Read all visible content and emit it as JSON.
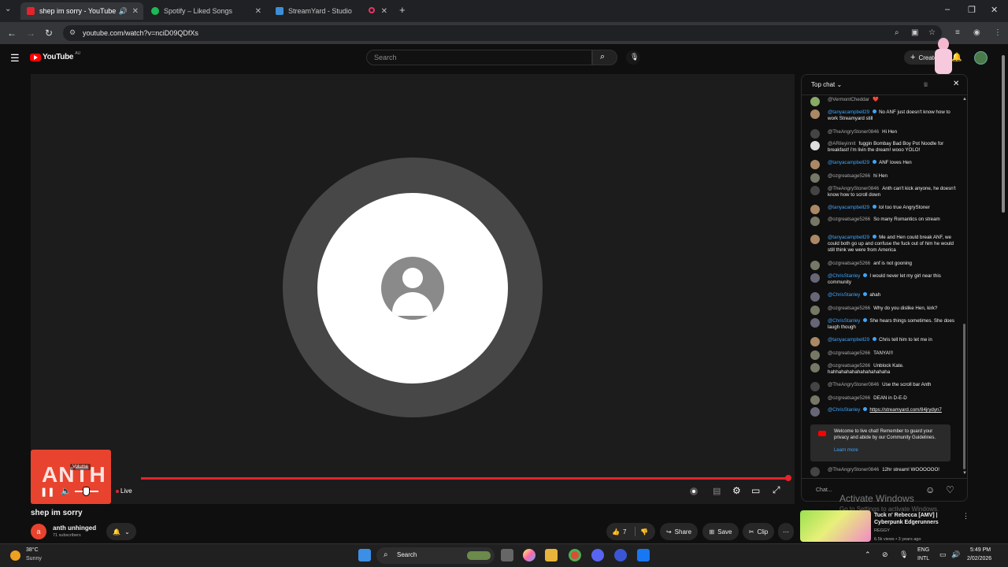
{
  "browser": {
    "tabs": [
      {
        "label": "shep im sorry - YouTube",
        "active": true
      },
      {
        "label": "Spotify – Liked Songs",
        "active": false
      },
      {
        "label": "StreamYard - Studio",
        "active": false
      }
    ],
    "url": "youtube.com/watch?v=nciD09QDfXs"
  },
  "youtube": {
    "logo": "YouTube",
    "region": "AU",
    "search_placeholder": "Search",
    "create_label": "Create"
  },
  "player": {
    "thumb_text": "ANTH",
    "volume_tooltip": "Volume",
    "live_label": "Live"
  },
  "chat": {
    "header": "Top chat",
    "messages": [
      {
        "author": "@VermontCheddar",
        "text": "❤️",
        "blue": false
      },
      {
        "author": "@tanyacampbell29",
        "text": "No ANF just doesn't know how to work Streamyard still",
        "blue": true
      },
      {
        "author": "@TheAngryStoner0846",
        "text": "Hi Hen",
        "blue": false
      },
      {
        "author": "@ARileyinnit",
        "text": "fuggin Bombay Bad Boy Pot Noodle for breakfast! i'm livin the dream! wooo YOLO!",
        "blue": false
      },
      {
        "author": "@tanyacampbell29",
        "text": "ANF loves Hen",
        "blue": true
      },
      {
        "author": "@ozgreatsage5266",
        "text": "hi Hen",
        "blue": false
      },
      {
        "author": "@TheAngryStoner0846",
        "text": "Anth can't kick anyone, he doesn't know how to scroll down",
        "blue": false
      },
      {
        "author": "@tanyacampbell29",
        "text": "lol too true AngryStoner",
        "blue": true
      },
      {
        "author": "@ozgreatsage5266",
        "text": "So many Romantics on stream",
        "blue": false
      },
      {
        "author": "@tanyacampbell29",
        "text": "Me and Hen could break ANF, we could both go up and confuse the fuck out of him he would still think we were from America",
        "blue": true
      },
      {
        "author": "@ozgreatsage5266",
        "text": "anf is not gooning",
        "blue": false
      },
      {
        "author": "@ChrisStanley",
        "text": "I would never let my girl near this community",
        "blue": true
      },
      {
        "author": "@ChrisStanley",
        "text": "ahah",
        "blue": true
      },
      {
        "author": "@ozgreatsage5266",
        "text": "Why do you dislike Hen, kirk?",
        "blue": false
      },
      {
        "author": "@ChrisStanley",
        "text": "She hears things sometimes. She does laugh though",
        "blue": true
      },
      {
        "author": "@tanyacampbell29",
        "text": "Chris tell him to let me in",
        "blue": true
      },
      {
        "author": "@ozgreatsage5266",
        "text": "TANYA!!!",
        "blue": false
      },
      {
        "author": "@ozgreatsage5266",
        "text": "Unblock Kate. hahhahahahahahahahahaha",
        "blue": false
      },
      {
        "author": "@TheAngryStoner0846",
        "text": "Use the scroll bar Anth",
        "blue": false
      },
      {
        "author": "@ozgreatsage5266",
        "text": "DEAN in D-E-D",
        "blue": false
      },
      {
        "author": "@ChrisStanley",
        "text": "https://streamyard.com/84jrydyn7",
        "blue": true
      }
    ],
    "welcome": "Welcome to live chat! Remember to guard your privacy and abide by our Community Guidelines.",
    "learn_more": "Learn more",
    "last_message": {
      "author": "@TheAngryStoner0846",
      "text": "12hr stream! WOOOOOO!"
    },
    "input_placeholder": "Chat..."
  },
  "video": {
    "title": "shep im sorry",
    "channel": "anth unhinged",
    "subscribers": "71 subscribers",
    "like_count": "7",
    "share_label": "Share",
    "save_label": "Save",
    "clip_label": "Clip"
  },
  "recommended": {
    "title": "Tuck n' Rebecca [AMV] | Cyberpunk Edgerunners",
    "channel": "REGGY",
    "meta": "6.5k views • 3 years ago"
  },
  "watermark": {
    "line1": "Activate Windows",
    "line2": "Go to Settings to activate Windows."
  },
  "taskbar": {
    "temp": "38°C",
    "weather": "Sunny",
    "search": "Search",
    "lang1": "ENG",
    "lang2": "INTL",
    "time": "5:49 PM",
    "date": "2/02/2026"
  },
  "colors": {
    "accent": "#e4232c",
    "link": "#3ea6ff",
    "thumb": "#e8432e"
  }
}
